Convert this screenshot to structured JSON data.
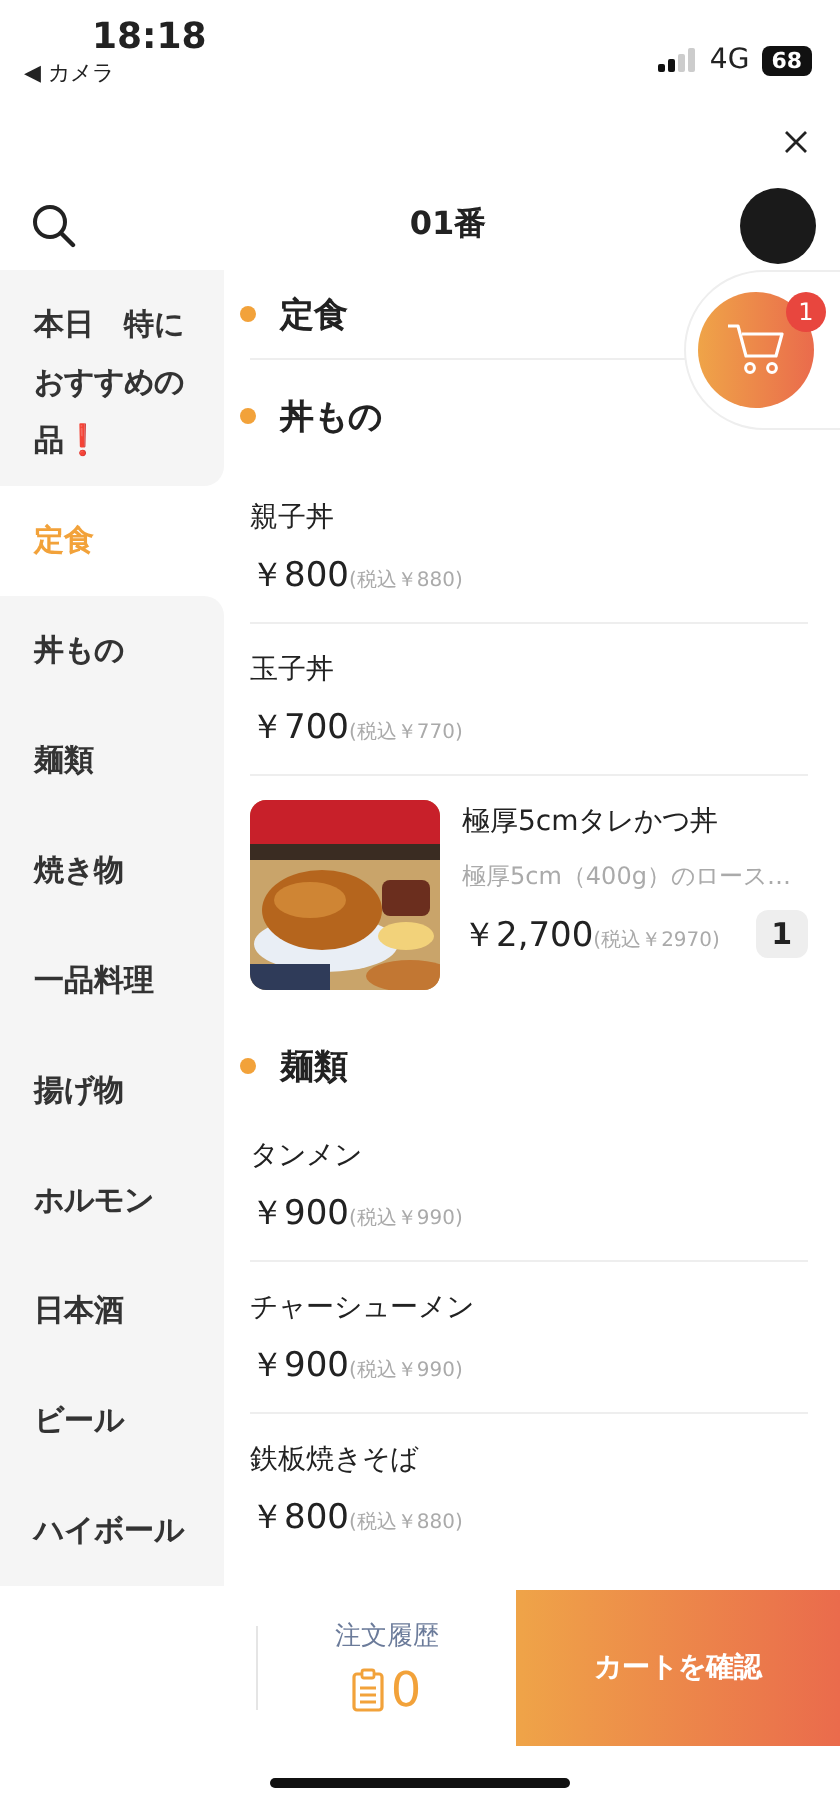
{
  "status_bar": {
    "time": "18:18",
    "back_label": "◀ カメラ",
    "network": "4G",
    "battery": "68"
  },
  "header": {
    "title": "01番"
  },
  "sidebar": {
    "items": [
      {
        "label": "本日　特におすすめの品❗",
        "selected": false
      },
      {
        "label": "定食",
        "selected": true
      },
      {
        "label": "丼もの",
        "selected": false
      },
      {
        "label": "麺類",
        "selected": false
      },
      {
        "label": "焼き物",
        "selected": false
      },
      {
        "label": "一品料理",
        "selected": false
      },
      {
        "label": "揚げ物",
        "selected": false
      },
      {
        "label": "ホルモン",
        "selected": false
      },
      {
        "label": "日本酒",
        "selected": false
      },
      {
        "label": "ビール",
        "selected": false
      },
      {
        "label": "ハイボール",
        "selected": false
      }
    ]
  },
  "menu_sections": [
    {
      "title": "定食"
    },
    {
      "title": "丼もの",
      "items": [
        {
          "kind": "plain",
          "name": "親子丼",
          "price": "￥800",
          "tax_price": "(税込￥880)"
        },
        {
          "kind": "plain",
          "name": "玉子丼",
          "price": "￥700",
          "tax_price": "(税込￥770)"
        },
        {
          "name": "極厚5cmタレかつ丼",
          "description": "極厚5cm（400g）のロース…",
          "price": "￥2,700",
          "tax_price": "(税込￥2970)",
          "quantity": "1"
        }
      ]
    },
    {
      "title": "麺類",
      "items": [
        {
          "kind": "plain",
          "name": "タンメン",
          "price": "￥900",
          "tax_price": "(税込￥990)"
        },
        {
          "kind": "plain",
          "name": "チャーシューメン",
          "price": "￥900",
          "tax_price": "(税込￥990)"
        },
        {
          "kind": "plain",
          "name": "鉄板焼きそば",
          "price": "￥800",
          "tax_price": "(税込￥880)"
        }
      ]
    }
  ],
  "cart": {
    "badge": "1"
  },
  "footer": {
    "history_label": "注文履歴",
    "history_count": "0",
    "checkout_button": "カートを確認"
  }
}
